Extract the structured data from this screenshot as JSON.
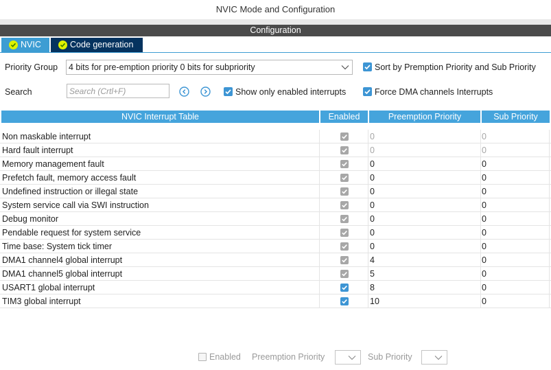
{
  "window": {
    "title": "NVIC Mode and Configuration"
  },
  "section": {
    "title": "Configuration"
  },
  "tabs": [
    {
      "label": "NVIC",
      "icon": "check-circle-icon",
      "active": true
    },
    {
      "label": "Code generation",
      "icon": "check-circle-icon",
      "active": false
    }
  ],
  "priority_group": {
    "label": "Priority Group",
    "value": "4 bits for pre-emption priority 0 bits for subpriority"
  },
  "search": {
    "label": "Search",
    "placeholder": "Search (Crtl+F)"
  },
  "options": {
    "sort_label": "Sort by Premption Priority and Sub Priority",
    "sort_checked": true,
    "show_enabled_label": "Show only enabled interrupts",
    "show_enabled_checked": true,
    "force_dma_label": "Force DMA channels Interrupts",
    "force_dma_checked": true
  },
  "table": {
    "headers": {
      "name": "NVIC Interrupt Table",
      "enabled": "Enabled",
      "preemption": "Preemption Priority",
      "sub": "Sub Priority"
    },
    "rows": [
      {
        "name": "Non maskable interrupt",
        "enabled": true,
        "editable": false,
        "preemption": "0",
        "sub": "0",
        "dim": true
      },
      {
        "name": "Hard fault interrupt",
        "enabled": true,
        "editable": false,
        "preemption": "0",
        "sub": "0",
        "dim": true
      },
      {
        "name": "Memory management fault",
        "enabled": true,
        "editable": false,
        "preemption": "0",
        "sub": "0",
        "dim": false
      },
      {
        "name": "Prefetch fault, memory access fault",
        "enabled": true,
        "editable": false,
        "preemption": "0",
        "sub": "0",
        "dim": false
      },
      {
        "name": "Undefined instruction or illegal state",
        "enabled": true,
        "editable": false,
        "preemption": "0",
        "sub": "0",
        "dim": false
      },
      {
        "name": "System service call via SWI instruction",
        "enabled": true,
        "editable": false,
        "preemption": "0",
        "sub": "0",
        "dim": false
      },
      {
        "name": "Debug monitor",
        "enabled": true,
        "editable": false,
        "preemption": "0",
        "sub": "0",
        "dim": false
      },
      {
        "name": "Pendable request for system service",
        "enabled": true,
        "editable": false,
        "preemption": "0",
        "sub": "0",
        "dim": false
      },
      {
        "name": "Time base: System tick timer",
        "enabled": true,
        "editable": false,
        "preemption": "0",
        "sub": "0",
        "dim": false
      },
      {
        "name": "DMA1 channel4 global interrupt",
        "enabled": true,
        "editable": false,
        "preemption": "4",
        "sub": "0",
        "dim": false
      },
      {
        "name": "DMA1 channel5 global interrupt",
        "enabled": true,
        "editable": false,
        "preemption": "5",
        "sub": "0",
        "dim": false
      },
      {
        "name": "USART1 global interrupt",
        "enabled": true,
        "editable": true,
        "preemption": "8",
        "sub": "0",
        "dim": false
      },
      {
        "name": "TIM3 global interrupt",
        "enabled": true,
        "editable": true,
        "preemption": "10",
        "sub": "0",
        "dim": false
      }
    ]
  },
  "bottom_bar": {
    "enabled_label": "Enabled",
    "preemption_label": "Preemption Priority",
    "sub_label": "Sub Priority"
  },
  "colors": {
    "accent": "#3d9dd3",
    "tab_dark": "#05335f",
    "header_bar": "#4b4b4b",
    "table_header": "#45a4dc",
    "check_disabled": "#a7a7a7"
  }
}
